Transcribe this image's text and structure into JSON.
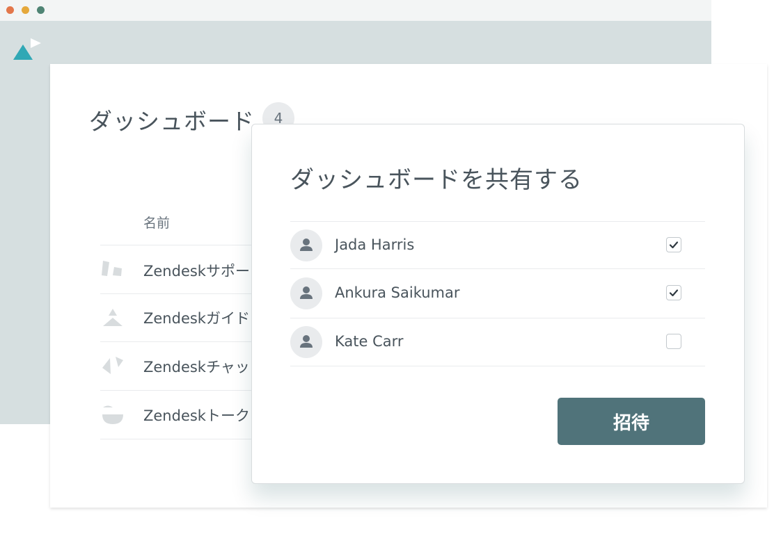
{
  "window": {
    "dot_colors": [
      "#e3774b",
      "#e5a83b",
      "#4f8474"
    ]
  },
  "dashboard": {
    "title": "ダッシュボード",
    "count": "4",
    "column_header": "名前",
    "items": [
      {
        "name": "Zendeskサポー",
        "icon": "support-icon"
      },
      {
        "name": "Zendeskガイド",
        "icon": "guide-icon"
      },
      {
        "name": "Zendeskチャッ",
        "icon": "chat-icon"
      },
      {
        "name": "Zendeskトーク",
        "icon": "talk-icon"
      }
    ]
  },
  "modal": {
    "title": "ダッシュボードを共有する",
    "users": [
      {
        "name": "Jada Harris",
        "checked": true
      },
      {
        "name": "Ankura Saikumar",
        "checked": true
      },
      {
        "name": "Kate Carr",
        "checked": false
      }
    ],
    "invite_label": "招待"
  },
  "colors": {
    "accent": "#50737a",
    "logo": "#30a8b5",
    "band": "#d6dfe0"
  }
}
